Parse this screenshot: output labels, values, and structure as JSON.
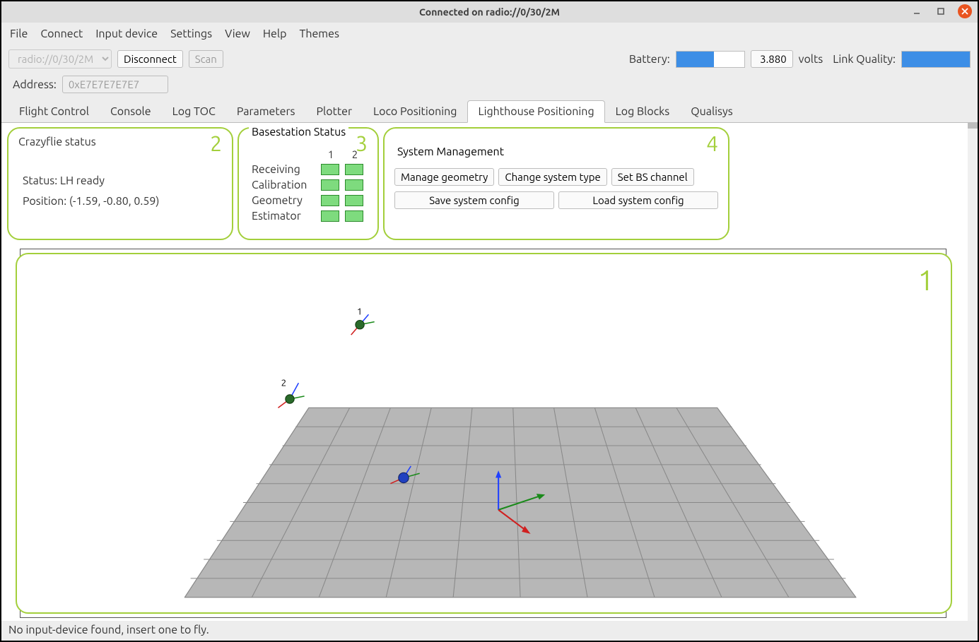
{
  "window": {
    "title": "Connected on radio://0/30/2M"
  },
  "menu": [
    "File",
    "Connect",
    "Input device",
    "Settings",
    "View",
    "Help",
    "Themes"
  ],
  "toolbar": {
    "uri_select": "radio://0/30/2M",
    "disconnect": "Disconnect",
    "scan": "Scan",
    "battery_label": "Battery:",
    "battery_value": "3.880",
    "battery_fill_pct": 56,
    "volts_label": "volts",
    "link_label": "Link Quality:",
    "link_fill_pct": 100
  },
  "address": {
    "label": "Address:",
    "value": "0xE7E7E7E7E7"
  },
  "tabs": [
    "Flight Control",
    "Console",
    "Log TOC",
    "Parameters",
    "Plotter",
    "Loco Positioning",
    "Lighthouse Positioning",
    "Log Blocks",
    "Qualisys"
  ],
  "active_tab": "Lighthouse Positioning",
  "crazyflie_status": {
    "title": "Crazyflie status",
    "status_label": "Status:",
    "status_value": "LH ready",
    "position_label": "Position:",
    "position_value": "(-1.59, -0.80, 0.59)",
    "annotation": "2"
  },
  "basestation": {
    "title": "Basestation Status",
    "columns": [
      "1",
      "2"
    ],
    "rows": [
      "Receiving",
      "Calibration",
      "Geometry",
      "Estimator"
    ],
    "annotation": "3"
  },
  "system_mgmt": {
    "title": "System Management",
    "buttons_row1": [
      "Manage geometry",
      "Change system type",
      "Set BS channel"
    ],
    "buttons_row2": [
      "Save system config",
      "Load system config"
    ],
    "annotation": "4"
  },
  "viz": {
    "annotation": "1",
    "bs_labels": [
      "1",
      "2"
    ]
  },
  "statusbar": "No input-device found, insert one to fly."
}
